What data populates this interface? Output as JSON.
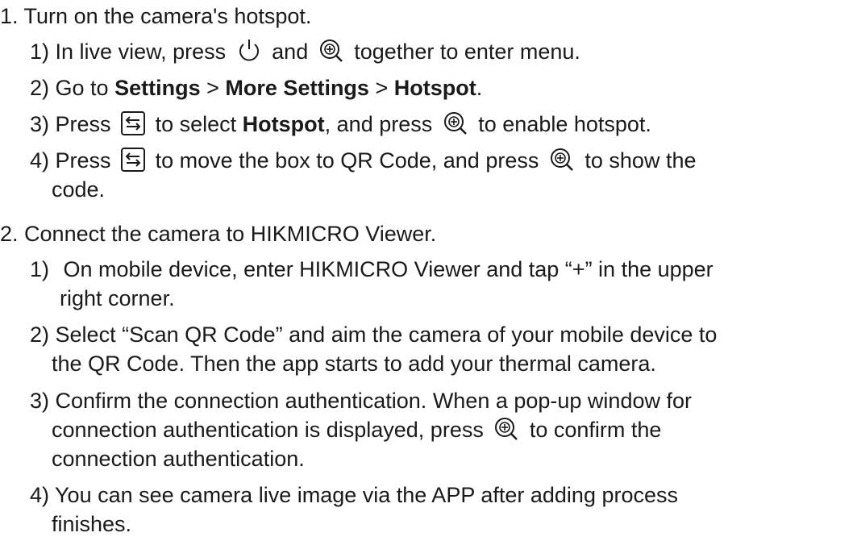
{
  "steps": [
    {
      "number": "1.",
      "title": "Turn on the camera's hotspot.",
      "substeps": [
        {
          "number": "1)",
          "pre": "In live view, press",
          "mid": "and",
          "post": "together to enter menu."
        },
        {
          "number": "2)",
          "pre": "Go to",
          "b1": "Settings",
          "sep1": ">",
          "b2": "More Settings",
          "sep2": ">",
          "b3": "Hotspot",
          "end": "."
        },
        {
          "number": "3)",
          "pre": "Press",
          "mid": "to select",
          "bold": "Hotspot",
          "mid2": ", and press",
          "post": "to enable hotspot."
        },
        {
          "number": "4)",
          "pre": "Press",
          "mid": "to move the box to QR Code, and press",
          "post": "to show the",
          "cont": "code."
        }
      ]
    },
    {
      "number": "2.",
      "title": "Connect the camera to HIKMICRO Viewer.",
      "substeps": [
        {
          "number": "1)",
          "text": "On mobile device, enter HIKMICRO Viewer and tap “+” in the upper",
          "cont": "right corner."
        },
        {
          "number": "2)",
          "text": "Select “Scan QR Code” and aim the camera of your mobile device to",
          "cont": "the QR Code. Then the app starts to add your thermal camera."
        },
        {
          "number": "3)",
          "text": "Confirm the connection authentication. When a pop-up window for",
          "pre2": "connection authentication is displayed, press",
          "post2": "to confirm the",
          "cont2": "connection authentication."
        },
        {
          "number": "4)",
          "text": "You can see camera live image via the APP after adding process",
          "cont": "finishes."
        }
      ]
    }
  ],
  "icons": {
    "power": "power-icon",
    "zoom": "zoom-plus-icon",
    "menu_switch": "menu-switch-icon"
  }
}
